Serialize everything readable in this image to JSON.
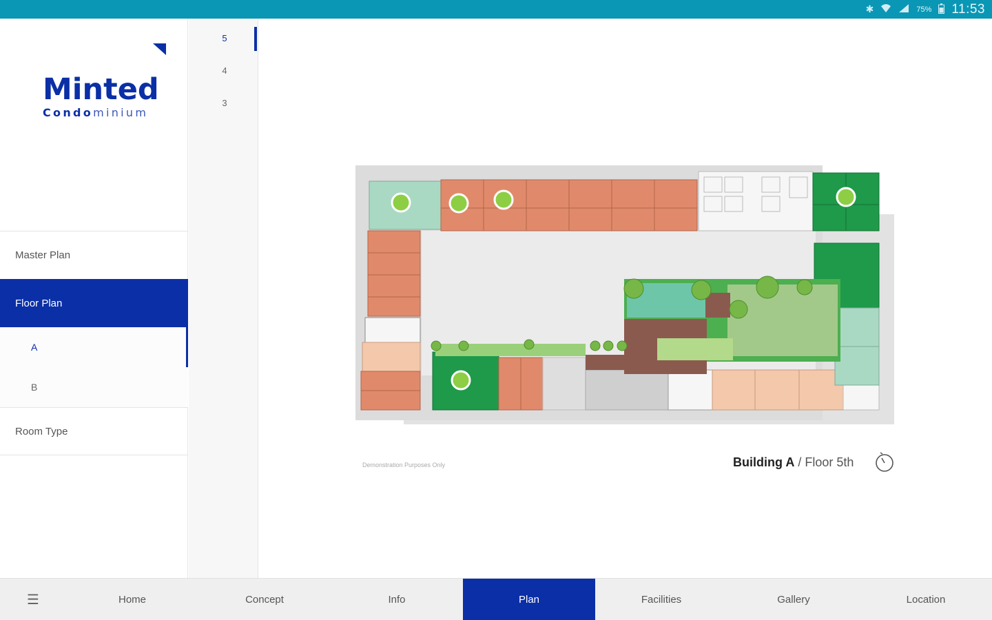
{
  "status_bar": {
    "battery": "75%",
    "time": "11:53",
    "icons": [
      "bluetooth-icon",
      "wifi-icon",
      "signal-icon",
      "battery-icon"
    ]
  },
  "brand": {
    "name": "Minted",
    "sub_bold": "Condo",
    "sub_light": "minium"
  },
  "sidebar": {
    "items": [
      {
        "label": "Master Plan"
      },
      {
        "label": "Floor Plan"
      },
      {
        "label": "Room Type"
      }
    ],
    "subitems": [
      {
        "label": "A"
      },
      {
        "label": "B"
      }
    ]
  },
  "floors": [
    "5",
    "4",
    "3"
  ],
  "plan": {
    "disclaimer": "Demonstration Purposes Only",
    "building": "Building A",
    "floor": " / Floor 5th"
  },
  "tabs": [
    {
      "label": "☰"
    },
    {
      "label": "Home"
    },
    {
      "label": "Concept"
    },
    {
      "label": "Info"
    },
    {
      "label": "Plan"
    },
    {
      "label": "Facilities"
    },
    {
      "label": "Gallery"
    },
    {
      "label": "Location"
    }
  ],
  "colors": {
    "brand_blue": "#0b2fa6",
    "status_bar": "#0a97b5",
    "unit_orange": "#e08a6b",
    "unit_green": "#1e9a4a",
    "unit_mint": "#a9d9c3",
    "marker_green": "#8dce45"
  }
}
